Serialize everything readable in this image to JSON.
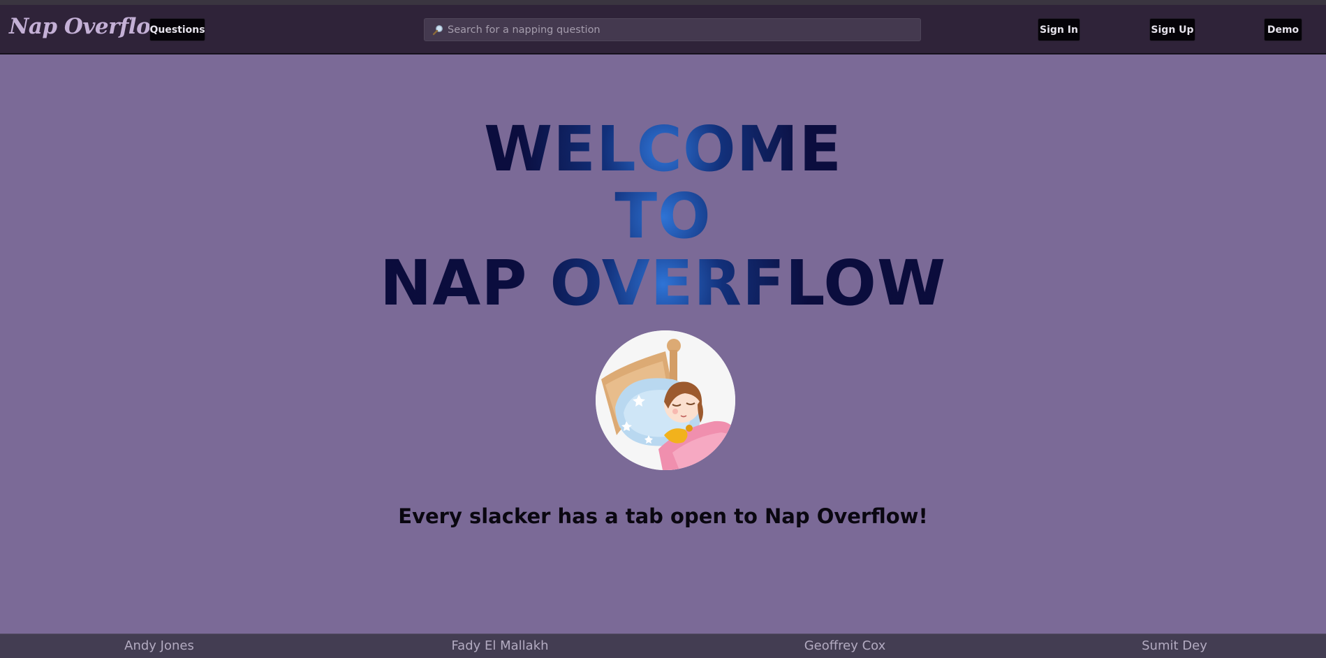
{
  "navbar": {
    "logo": "Nap Overflow",
    "questions_label": "Questions",
    "search": {
      "placeholder": "Search for a napping question",
      "icon": "magnifier-icon"
    },
    "sign_in_label": "Sign In",
    "sign_up_label": "Sign Up",
    "demo_label": "Demo"
  },
  "hero": {
    "line1": "WELCOME",
    "line2": "TO",
    "line3": "NAP OVERFLOW"
  },
  "tagline": "Every slacker has a tab open to Nap Overflow!",
  "footer": {
    "names": [
      "Andy Jones",
      "Fady El Mallakh",
      "Geoffrey Cox",
      "Sumit Dey"
    ]
  },
  "colors": {
    "background": "#7b6a97",
    "navbar": "#2f2339",
    "button": "#050308",
    "hero_text": "#0b0b35",
    "footer": "#433d52"
  }
}
